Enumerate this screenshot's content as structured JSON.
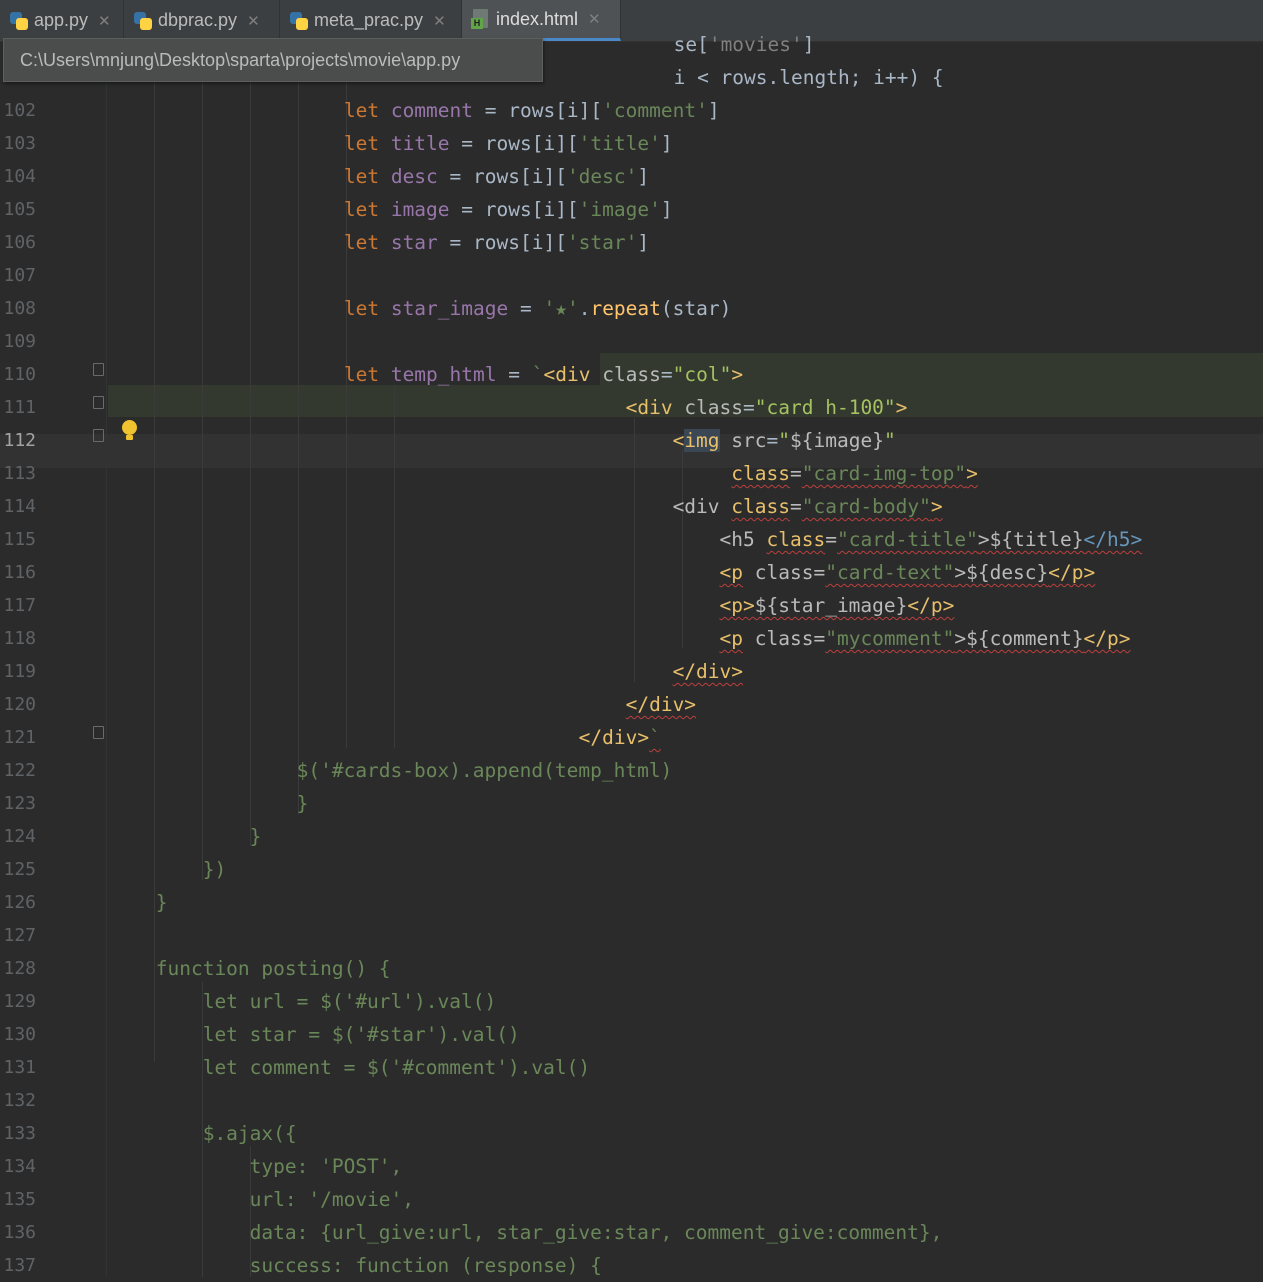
{
  "tabs": [
    {
      "label": "app.py",
      "icon": "python-file-icon",
      "active": false
    },
    {
      "label": "dbprac.py",
      "icon": "python-file-icon",
      "active": false
    },
    {
      "label": "meta_prac.py",
      "icon": "python-file-icon",
      "active": false
    },
    {
      "label": "index.html",
      "icon": "html-file-icon",
      "active": true
    }
  ],
  "close_glyph": "✕",
  "tooltip": "C:\\Users\\mnjung\\Desktop\\sparta\\projects\\movie\\app.py",
  "theme": {
    "background": "#2b2b2b",
    "keyword": "#cc7832",
    "string": "#6a8759",
    "function": "#ffc66d",
    "html_tag": "#e8bf6a",
    "variable": "#9876aa",
    "current_line": "#323232",
    "injected_highlight": "#33392f"
  },
  "editor": {
    "current_line": "112",
    "lines": [
      {
        "n": "",
        "text": "                                        se['movies']"
      },
      {
        "n": "",
        "text": "                                        i < rows.length; i++) {"
      },
      {
        "n": "102",
        "text": "                let comment = rows[i]['comment']"
      },
      {
        "n": "103",
        "text": "                let title = rows[i]['title']"
      },
      {
        "n": "104",
        "text": "                let desc = rows[i]['desc']"
      },
      {
        "n": "105",
        "text": "                let image = rows[i]['image']"
      },
      {
        "n": "106",
        "text": "                let star = rows[i]['star']"
      },
      {
        "n": "107",
        "text": ""
      },
      {
        "n": "108",
        "text": "                let star_image = '★'.repeat(star)"
      },
      {
        "n": "109",
        "text": ""
      },
      {
        "n": "110",
        "text": "                let temp_html = `<div class=\"col\">"
      },
      {
        "n": "111",
        "text": "                                        <div class=\"card h-100\">"
      },
      {
        "n": "112",
        "text": "                                            <img src=\"${image}\""
      },
      {
        "n": "113",
        "text": "                                                 class=\"card-img-top\">"
      },
      {
        "n": "114",
        "text": "                                            <div class=\"card-body\">"
      },
      {
        "n": "115",
        "text": "                                                <h5 class=\"card-title\">${title}</h5>"
      },
      {
        "n": "116",
        "text": "                                                <p class=\"card-text\">${desc}</p>"
      },
      {
        "n": "117",
        "text": "                                                <p>${star_image}</p>"
      },
      {
        "n": "118",
        "text": "                                                <p class=\"mycomment\">${comment}</p>"
      },
      {
        "n": "119",
        "text": "                                            </div>"
      },
      {
        "n": "120",
        "text": "                                        </div>"
      },
      {
        "n": "121",
        "text": "                                    </div>`"
      },
      {
        "n": "122",
        "text": "             $('#cards-box).append(temp_html)"
      },
      {
        "n": "123",
        "text": "             }"
      },
      {
        "n": "124",
        "text": "         }"
      },
      {
        "n": "125",
        "text": "     })"
      },
      {
        "n": "126",
        "text": " }"
      },
      {
        "n": "127",
        "text": ""
      },
      {
        "n": "128",
        "text": " function posting() {"
      },
      {
        "n": "129",
        "text": "     let url = $('#url').val()"
      },
      {
        "n": "130",
        "text": "     let star = $('#star').val()"
      },
      {
        "n": "131",
        "text": "     let comment = $('#comment').val()"
      },
      {
        "n": "132",
        "text": ""
      },
      {
        "n": "133",
        "text": "     $.ajax({"
      },
      {
        "n": "134",
        "text": "         type: 'POST',"
      },
      {
        "n": "135",
        "text": "         url: '/movie',"
      },
      {
        "n": "136",
        "text": "         data: {url_give:url, star_give:star, comment_give:comment},"
      },
      {
        "n": "137",
        "text": "         success: function (response) {"
      }
    ]
  }
}
